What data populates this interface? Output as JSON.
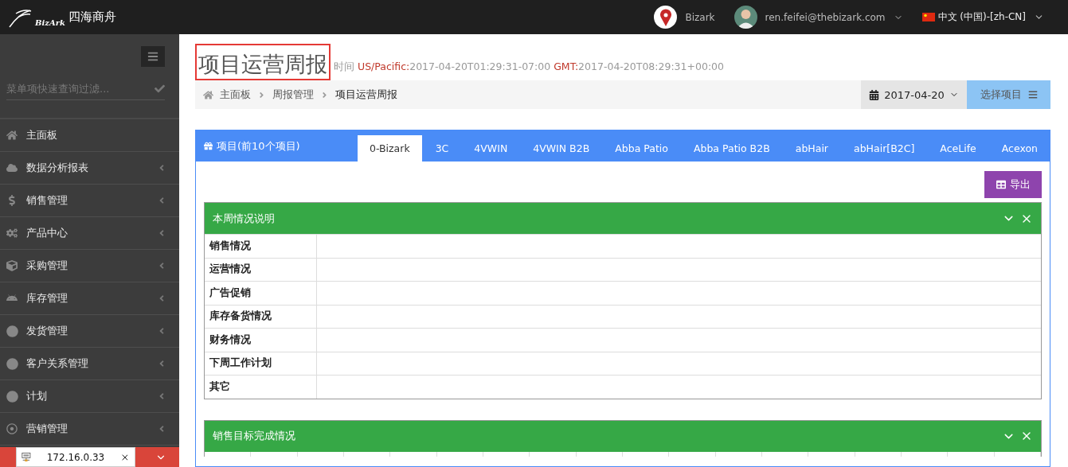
{
  "brand": {
    "logo_text": "BizArk",
    "name": "四海商舟"
  },
  "topbar": {
    "company": "Bizark",
    "user": "ren.feifei@thebizark.com",
    "language": "中文 (中国)-[zh-CN]"
  },
  "sidebar": {
    "search_placeholder": "菜单项快速查询过滤...",
    "items": [
      {
        "label": "主面板",
        "expandable": false
      },
      {
        "label": "数据分析报表",
        "expandable": true
      },
      {
        "label": "销售管理",
        "expandable": true
      },
      {
        "label": "产品中心",
        "expandable": true
      },
      {
        "label": "采购管理",
        "expandable": true
      },
      {
        "label": "库存管理",
        "expandable": true
      },
      {
        "label": "发货管理",
        "expandable": true
      },
      {
        "label": "客户关系管理",
        "expandable": true
      },
      {
        "label": "计划",
        "expandable": true
      },
      {
        "label": "营销管理",
        "expandable": true
      }
    ]
  },
  "popup": {
    "address": "172.16.0.33"
  },
  "page": {
    "title": "项目运营周报",
    "time_label": "时间",
    "pacific_label": "US/Pacific:",
    "pacific_time": "2017-04-20T01:29:31-07:00",
    "gmt_label": "GMT:",
    "gmt_time": "2017-04-20T08:29:31+00:00"
  },
  "breadcrumb": [
    "主面板",
    "周报管理",
    "项目运营周报"
  ],
  "toolbar": {
    "date": "2017-04-20",
    "select_project": "选择项目"
  },
  "projects": {
    "title": "项目(前10个项目)",
    "export": "导出",
    "tabs": [
      {
        "label": "0-Bizark",
        "selected": true
      },
      {
        "label": "3C",
        "selected": false
      },
      {
        "label": "4VWIN",
        "selected": false
      },
      {
        "label": "4VWIN B2B",
        "selected": false
      },
      {
        "label": "Abba Patio",
        "selected": false
      },
      {
        "label": "Abba Patio B2B",
        "selected": false
      },
      {
        "label": "abHair",
        "selected": false
      },
      {
        "label": "abHair[B2C]",
        "selected": false
      },
      {
        "label": "AceLife",
        "selected": false
      },
      {
        "label": "Acexon",
        "selected": false
      }
    ]
  },
  "sections": [
    {
      "title": "本周情况说明",
      "rows": [
        "销售情况",
        "运营情况",
        "广告促销",
        "库存备货情况",
        "财务情况",
        "下周工作计划",
        "其它"
      ]
    },
    {
      "title": "销售目标完成情况"
    }
  ]
}
